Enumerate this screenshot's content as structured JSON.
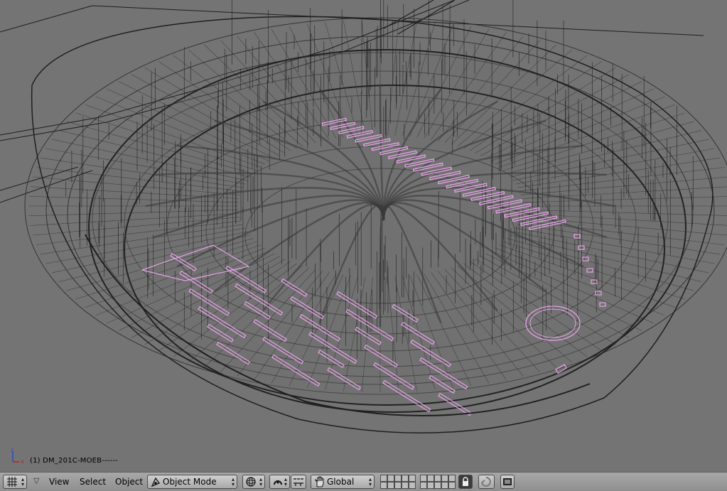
{
  "viewport": {
    "object_label": "(1) DM_201C-MOEB------",
    "axis": {
      "z": "z",
      "x": "x"
    },
    "colors": {
      "background": "#747474",
      "wire": "#2f2f2f",
      "selected": "#e6a3e6"
    }
  },
  "header": {
    "view_type_icon": "grid-icon",
    "menus": {
      "view": "View",
      "select": "Select",
      "object": "Object"
    },
    "mode": {
      "label": "Object Mode",
      "icon": "object-mode-icon"
    },
    "draw_type_icon": "sphere-icon",
    "pivot_icon": "pivot-icon",
    "transform_icons": [
      "magnet-icon",
      "manipulator-icon"
    ],
    "orientation": {
      "label": "Global",
      "icon": "hand-icon"
    },
    "layers_icon": "layers-icon",
    "lock_icon": "lock-icon",
    "render_icons": [
      "undo-icon",
      "render-icon"
    ]
  }
}
